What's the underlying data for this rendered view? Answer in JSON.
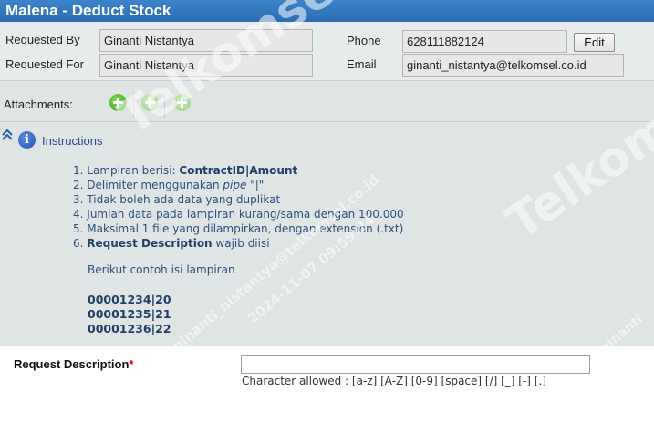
{
  "title": "Malena - Deduct Stock",
  "requester": {
    "requested_by_label": "Requested By",
    "requested_by_value": "Ginanti Nistantya",
    "requested_for_label": "Requested For",
    "requested_for_value": "Ginanti Nistantya",
    "phone_label": "Phone",
    "phone_value": "628111882124",
    "email_label": "Email",
    "email_value": "ginanti_nistantya@telkomsel.co.id",
    "edit_label": "Edit"
  },
  "attachments": {
    "label": "Attachments:",
    "icons": [
      "add-icon",
      "add-icon",
      "add-icon"
    ]
  },
  "instructions": {
    "link": "Instructions",
    "items": [
      {
        "n": "1.",
        "pre": "Lampiran berisi: ",
        "bold": "ContractID|Amount",
        "post": ""
      },
      {
        "n": "2.",
        "pre": "Delimiter menggunakan ",
        "italic": "pipe",
        "post": " \"|\""
      },
      {
        "n": "3.",
        "text": "Tidak boleh ada data yang duplikat"
      },
      {
        "n": "4.",
        "text": "Jumlah data pada lampiran kurang/sama dengan 100.000"
      },
      {
        "n": "5.",
        "text": "Maksimal 1 file yang dilampirkan, dengan extension (.txt)"
      },
      {
        "n": "6.",
        "bold": "Request Description",
        "post": " wajib diisi"
      }
    ],
    "sample_intro": "Berikut contoh isi lampiran",
    "samples": [
      "00001234|20",
      "00001235|21",
      "00001236|22"
    ]
  },
  "request": {
    "label": "Request Description",
    "required_mark": "*",
    "value": "",
    "hint": "Character allowed : [a-z] [A-Z] [0-9] [space] [/] [_] [-] [.]"
  },
  "watermark": {
    "brand": "Telkomsel",
    "user": "ginanti_nistantya@telkomsel.co.id",
    "timestamp": "2024-11-07 09:59:24",
    "short": "ginanti"
  }
}
